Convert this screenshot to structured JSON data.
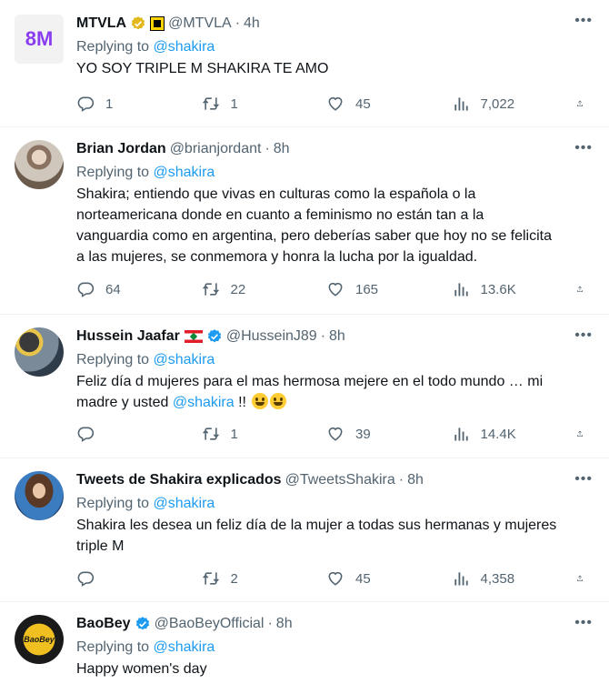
{
  "tweets": [
    {
      "name": "MTVLA",
      "handle": "@MTVLA",
      "time": "4h",
      "reply_prefix": "Replying to",
      "reply_to": "@shakira",
      "text": "YO SOY TRIPLE M SHAKIRA TE AMO",
      "replies": "1",
      "retweets": "1",
      "likes": "45",
      "views": "7,022",
      "verified": "gold",
      "avatar_text": "8M"
    },
    {
      "name": "Brian Jordan",
      "handle": "@brianjordant",
      "time": "8h",
      "reply_prefix": "Replying to",
      "reply_to": "@shakira",
      "text": "Shakira; entiendo que vivas en culturas como la española o la\nnorteamericana donde en cuanto a feminismo no están tan a la\nvanguardia como en argentina, pero deberías saber que hoy no se felicita\na las mujeres, se conmemora y honra la lucha por la igualdad.",
      "replies": "64",
      "retweets": "22",
      "likes": "165",
      "views": "13.6K"
    },
    {
      "name": "Hussein Jaafar",
      "handle": "@HusseinJ89",
      "time": "8h",
      "reply_prefix": "Replying to",
      "reply_to": "@shakira",
      "text_a": "Feliz día d mujeres para el mas hermosa mejere en el todo mundo … mi\nmadre y usted ",
      "text_mention": "@shakira",
      "text_b": " !! ",
      "replies": "",
      "retweets": "1",
      "likes": "39",
      "views": "14.4K",
      "verified": "blue"
    },
    {
      "name": "Tweets de Shakira explicados",
      "handle": "@TweetsShakira",
      "time": "8h",
      "reply_prefix": "Replying to",
      "reply_to": "@shakira",
      "text": "Shakira les desea un feliz día de la mujer a todas sus hermanas y mujeres\ntriple M",
      "replies": "",
      "retweets": "2",
      "likes": "45",
      "views": "4,358"
    },
    {
      "name": "BaoBey",
      "handle": "@BaoBeyOfficial",
      "time": "8h",
      "reply_prefix": "Replying to",
      "reply_to": "@shakira",
      "text": "Happy women's day",
      "verified": "blue",
      "avatar_text": "BaoBey"
    }
  ],
  "colors": {
    "link": "#1d9bf0",
    "muted": "#536471",
    "gold": "#e2b719",
    "blue": "#1d9bf0"
  },
  "dot": "·",
  "more": "•••"
}
